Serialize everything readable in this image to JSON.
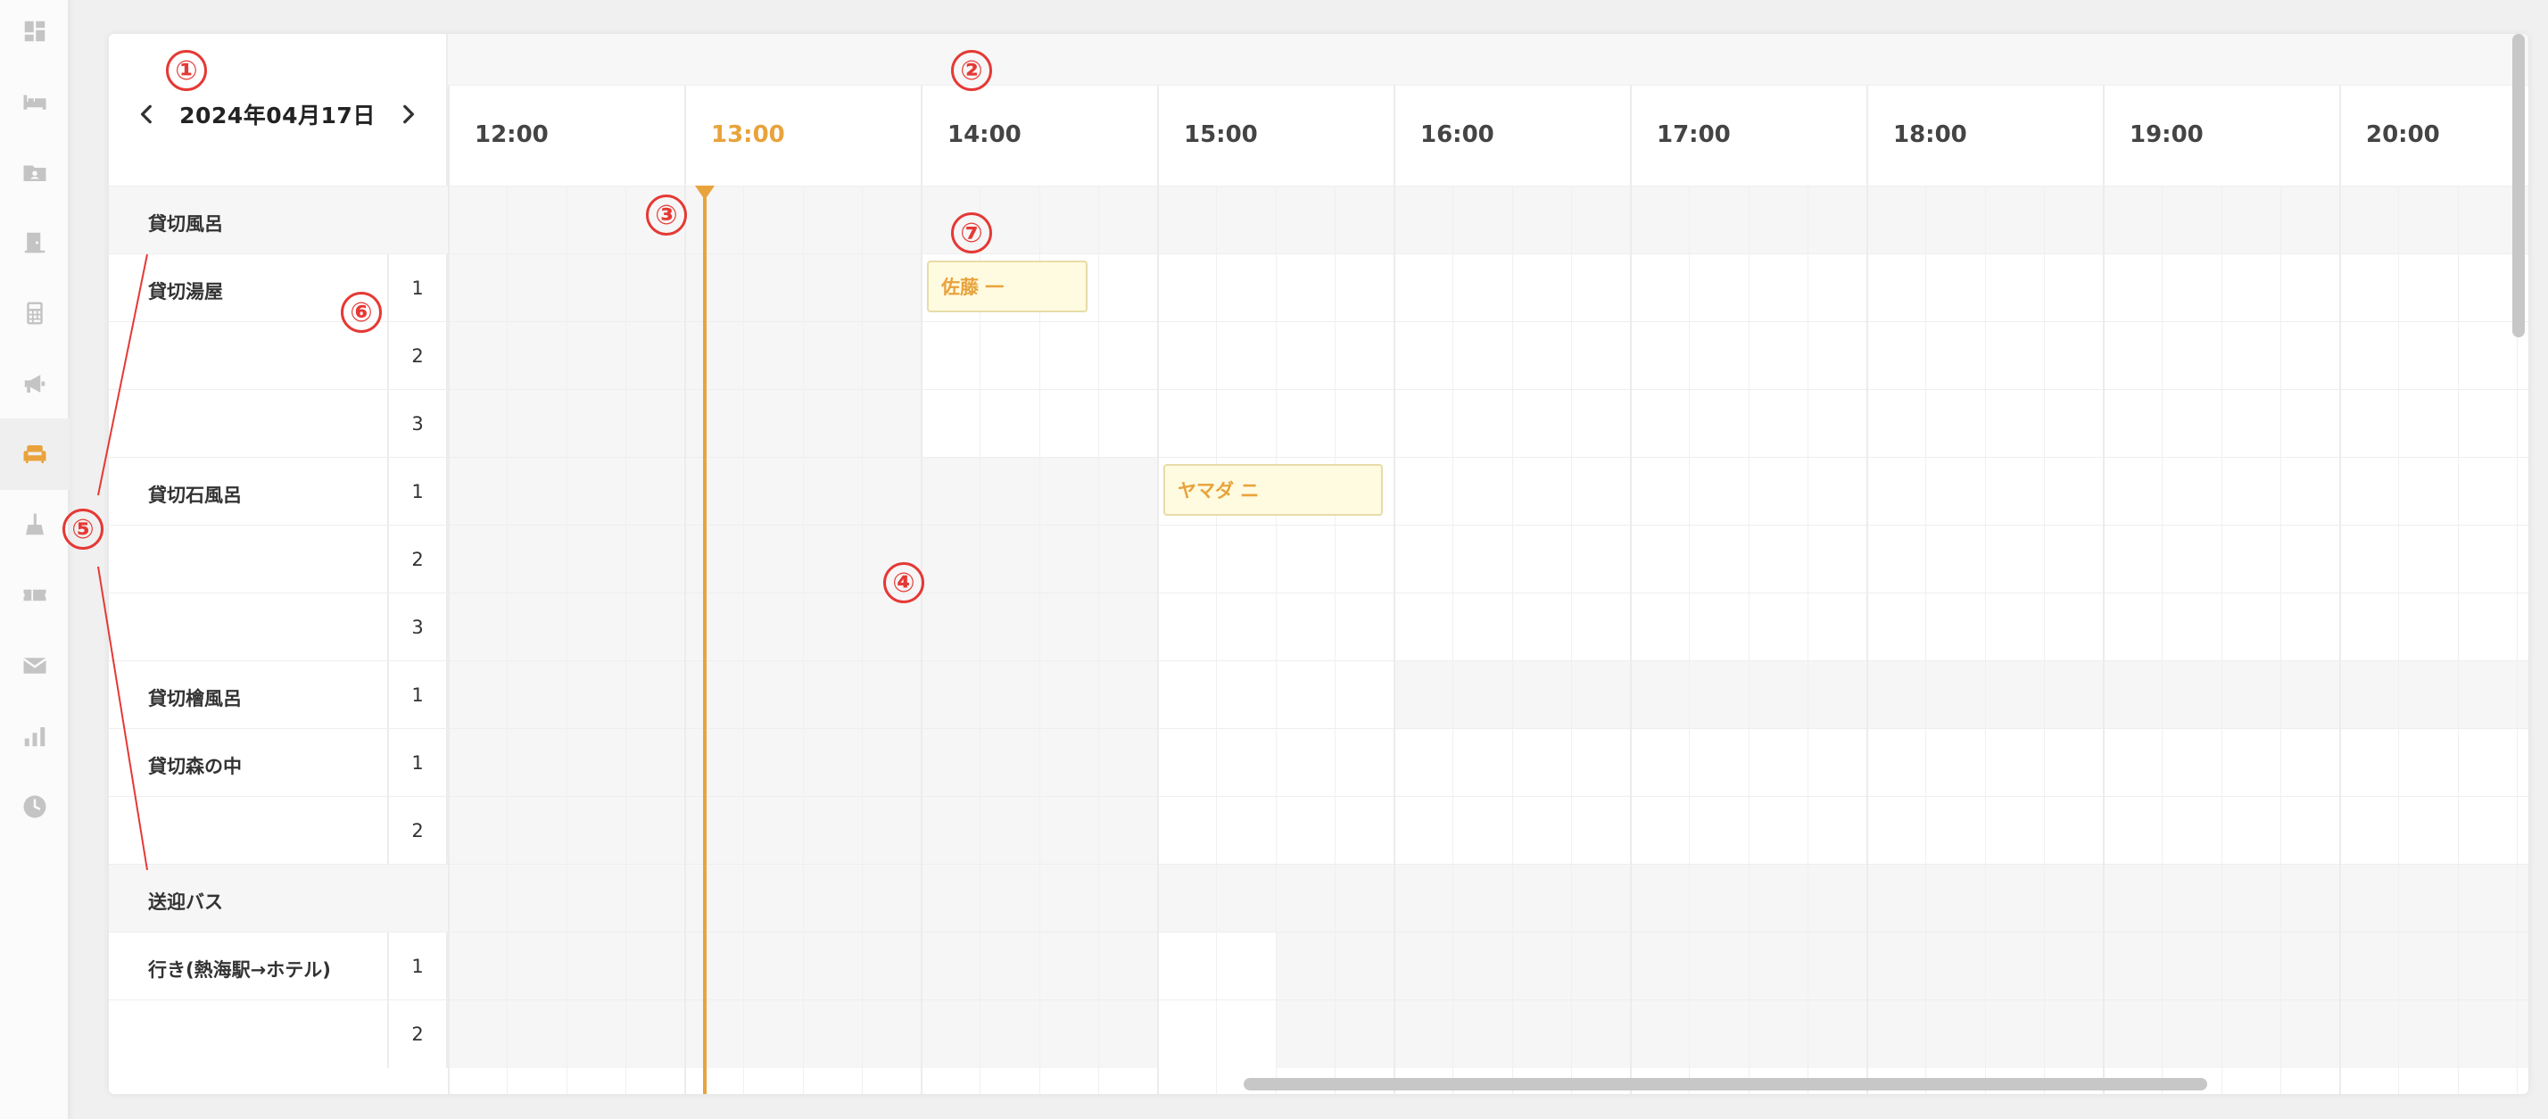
{
  "sidebar": {
    "items": [
      {
        "icon": "dashboard-icon"
      },
      {
        "icon": "bed-icon"
      },
      {
        "icon": "folder-user-icon"
      },
      {
        "icon": "door-icon"
      },
      {
        "icon": "calculator-icon"
      },
      {
        "icon": "megaphone-icon"
      },
      {
        "icon": "sofa-icon",
        "active": true
      },
      {
        "icon": "broom-icon"
      },
      {
        "icon": "ticket-icon"
      },
      {
        "icon": "mail-icon"
      },
      {
        "icon": "bar-chart-icon"
      },
      {
        "icon": "clock-icon"
      }
    ],
    "active_color": "#e8a33c",
    "icon_color": "#c4c4c4"
  },
  "header": {
    "date": "2024年04月17日",
    "times": [
      "12:00",
      "13:00",
      "14:00",
      "15:00",
      "16:00",
      "17:00",
      "18:00",
      "19:00",
      "20:00"
    ],
    "current_hour": "13:00"
  },
  "rows": [
    {
      "section": "貸切風呂"
    },
    {
      "name": "貸切湯屋",
      "num": "1"
    },
    {
      "name": "",
      "num": "2"
    },
    {
      "name": "",
      "num": "3"
    },
    {
      "name": "貸切石風呂",
      "num": "1"
    },
    {
      "name": "",
      "num": "2"
    },
    {
      "name": "",
      "num": "3"
    },
    {
      "name": "貸切檜風呂",
      "num": "1"
    },
    {
      "name": "貸切森の中",
      "num": "1"
    },
    {
      "name": "",
      "num": "2"
    },
    {
      "section": "送迎バス"
    },
    {
      "name": "行き(熱海駅→ホテル)",
      "num": "1"
    },
    {
      "name": "",
      "num": "2"
    }
  ],
  "bookings": [
    {
      "name": "佐藤 一",
      "row": 1
    },
    {
      "name": "ヤマダ ニ",
      "row": 4
    }
  ],
  "annotations": [
    "①",
    "②",
    "③",
    "④",
    "⑤",
    "⑥",
    "⑦"
  ],
  "colors": {
    "accent": "#e8a33c",
    "booking_bg": "#fffbe0",
    "annotation": "#e53935"
  }
}
